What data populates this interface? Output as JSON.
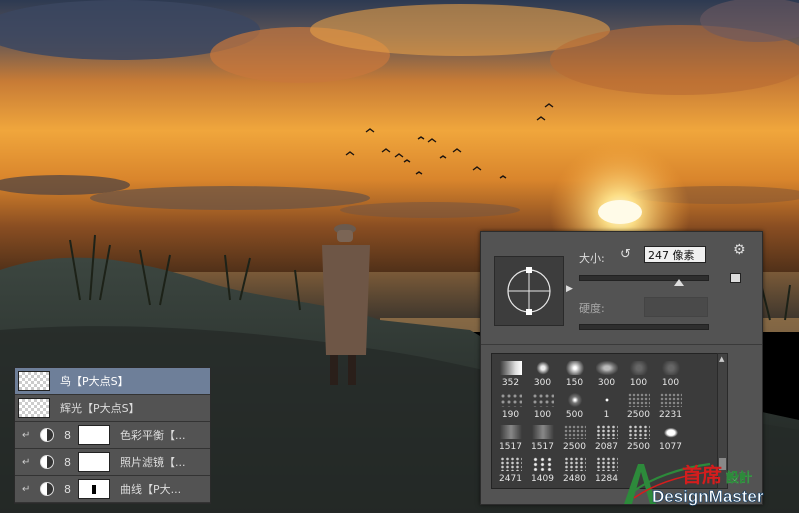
{
  "layers": [
    {
      "name": "鸟【P大点S】",
      "type": "pixel",
      "selected": true
    },
    {
      "name": "辉光【P大点S】",
      "type": "pixel",
      "selected": false
    },
    {
      "name": "色彩平衡【...",
      "type": "adjustment",
      "selected": false
    },
    {
      "name": "照片滤镜【...",
      "type": "adjustment",
      "selected": false
    },
    {
      "name": "曲线【P大...",
      "type": "adjustment",
      "mask": "curve",
      "selected": false
    }
  ],
  "brush_panel": {
    "size_label": "大小:",
    "size_value": "247 像素",
    "size_fraction": 0.78,
    "hardness_label": "硬度:",
    "icons": {
      "reset": "reset-size-icon",
      "settings": "gear-icon",
      "new_preset": "new-preset-icon",
      "preview_menu": "triangle-right-icon",
      "scroll_up": "scroll-up-arrow-icon"
    },
    "presets": [
      {
        "size": "352",
        "style": "streak"
      },
      {
        "size": "300",
        "style": "spray"
      },
      {
        "size": "150",
        "style": "glow"
      },
      {
        "size": "300",
        "style": "cloud"
      },
      {
        "size": "100",
        "style": "soft"
      },
      {
        "size": "100",
        "style": "soft"
      },
      {
        "size": "190",
        "style": "dots"
      },
      {
        "size": "100",
        "style": "dots"
      },
      {
        "size": "500",
        "style": "spark"
      },
      {
        "size": "1",
        "style": "dot"
      },
      {
        "size": "2500",
        "style": "grain"
      },
      {
        "size": "2231",
        "style": "grain"
      },
      {
        "size": "1517",
        "style": "stroke"
      },
      {
        "size": "1517",
        "style": "stroke"
      },
      {
        "size": "2500",
        "style": "grain"
      },
      {
        "size": "2087",
        "style": "scatter"
      },
      {
        "size": "2500",
        "style": "scatter"
      },
      {
        "size": "1077",
        "style": "bird"
      },
      {
        "size": "2471",
        "style": "scatter"
      },
      {
        "size": "1409",
        "style": "birds"
      },
      {
        "size": "2480",
        "style": "scatter"
      },
      {
        "size": "1284",
        "style": "scatter"
      },
      {
        "size": "",
        "style": "empty"
      },
      {
        "size": "",
        "style": "empty"
      }
    ]
  },
  "watermark": {
    "chinese": "首席",
    "chinese_small": "設計",
    "latin": "DesignMaster"
  },
  "colors": {
    "sky_top": "#2f3d55",
    "sky_glow": "#f2a23a",
    "sun": "#fff5c2",
    "sea": "#3c3a38",
    "dune": "#2a302c",
    "panel_bg": "#535353",
    "selected_layer": "#6e7f99",
    "logo_red": "#d41d1d",
    "logo_green": "#2d8a3b"
  }
}
